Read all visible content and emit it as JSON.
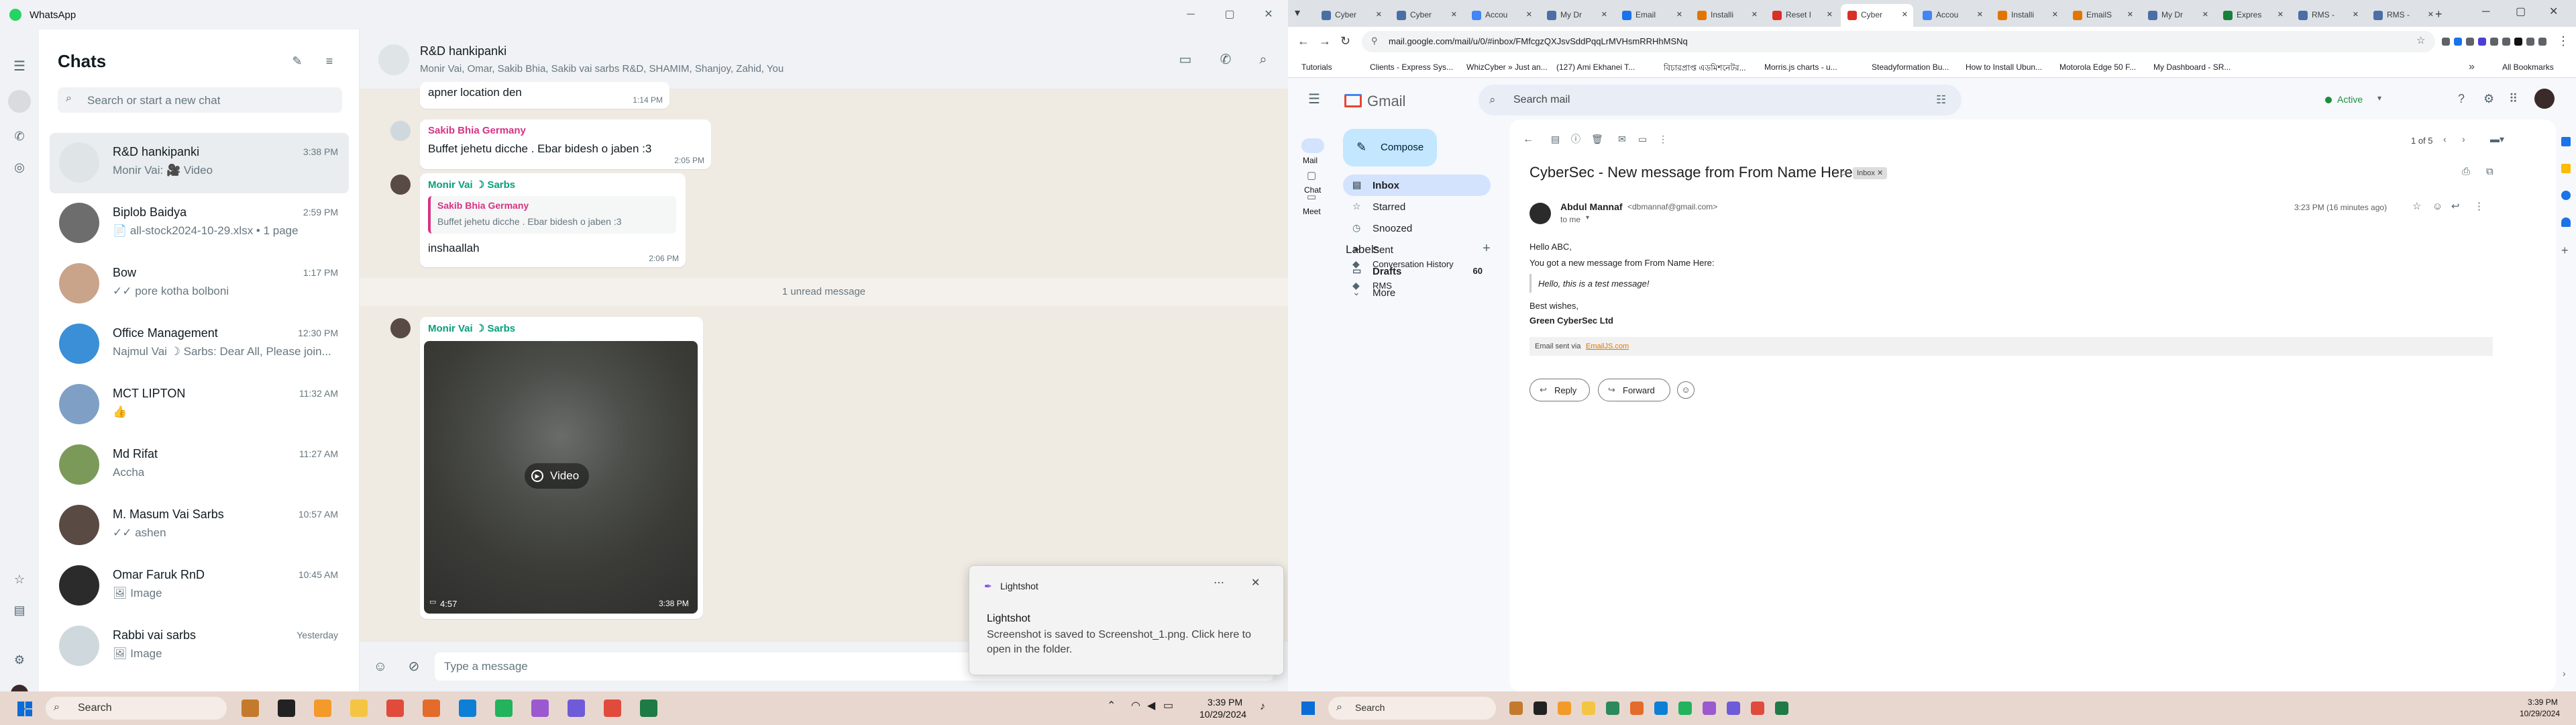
{
  "whatsapp": {
    "title": "WhatsApp",
    "list_title": "Chats",
    "search_placeholder": "Search or start a new chat",
    "chats": [
      {
        "name": "R&D hankipanki",
        "time": "3:38 PM",
        "snippet": "Monir Vai: 🎥 Video",
        "avatar_color": "#dfe5e7"
      },
      {
        "name": "Biplob Baidya",
        "time": "2:59 PM",
        "snippet": "📄 all-stock2024-10-29.xlsx • 1 page",
        "avatar_color": "#6d6d6d"
      },
      {
        "name": "Bow",
        "time": "1:17 PM",
        "snippet": "✓✓ pore kotha bolboni",
        "avatar_color": "#c9a48a"
      },
      {
        "name": "Office Management",
        "time": "12:30 PM",
        "snippet": "Najmul Vai ☽ Sarbs: Dear All, Please join...",
        "avatar_color": "#3a8fd6"
      },
      {
        "name": "MCT LIPTON",
        "time": "11:32 AM",
        "snippet": "👍",
        "avatar_color": "#7fa0c4"
      },
      {
        "name": "Md Rifat",
        "time": "11:27 AM",
        "snippet": "Accha",
        "avatar_color": "#7b9a5a"
      },
      {
        "name": "M. Masum Vai Sarbs",
        "time": "10:57 AM",
        "snippet": "✓✓ ashen",
        "avatar_color": "#5a4a44"
      },
      {
        "name": "Omar Faruk RnD",
        "time": "10:45 AM",
        "snippet": "🖼 Image",
        "avatar_color": "#2b2b2b"
      },
      {
        "name": "Rabbi vai sarbs",
        "time": "Yesterday",
        "snippet": "🖼 Image",
        "avatar_color": "#cfd8dc"
      }
    ],
    "chat_header": {
      "name": "R&D hankipanki",
      "members": "Monir Vai, Omar, Sakib Bhia, Sakib vai sarbs R&D, SHAMIM, Shanjoy, Zahid, You"
    },
    "messages": {
      "m1_text": "apner location den",
      "m1_time": "1:14 PM",
      "m2_sender": "Sakib Bhia Germany",
      "m2_text": "Buffet jehetu dicche . Ebar bidesh o jaben :3",
      "m2_time": "2:05 PM",
      "m3_sender": "Monir Vai ☽ Sarbs",
      "m3_quote_sender": "Sakib Bhia Germany",
      "m3_quote_text": "Buffet jehetu dicche . Ebar bidesh o jaben :3",
      "m3_text": "inshaallah",
      "m3_time": "2:06 PM",
      "unread_divider": "1 unread message",
      "m4_sender": "Monir Vai ☽ Sarbs",
      "m4_video_label": "Video",
      "m4_duration": "4:57",
      "m4_time": "3:38 PM"
    },
    "composer_placeholder": "Type a message",
    "toast": {
      "app": "Lightshot",
      "title": "Lightshot",
      "body": "Screenshot is saved to Screenshot_1.png. Click here to open in the folder."
    }
  },
  "taskbar_left": {
    "search_placeholder": "Search",
    "time": "3:39 PM",
    "date": "10/29/2024"
  },
  "taskbar_right": {
    "search_placeholder": "Search",
    "time": "3:39 PM",
    "date": "10/29/2024"
  },
  "chrome": {
    "tabs": [
      {
        "label": "Cyber",
        "color": "#4a6fa5"
      },
      {
        "label": "Cyber",
        "color": "#4a6fa5"
      },
      {
        "label": "Accou",
        "color": "#4285f4"
      },
      {
        "label": "My Dr",
        "color": "#4a6fa5"
      },
      {
        "label": "Email",
        "color": "#1a73e8"
      },
      {
        "label": "Installi",
        "color": "#e37400"
      },
      {
        "label": "Reset I",
        "color": "#d93025"
      },
      {
        "label": "Cyber",
        "color": "#d93025"
      },
      {
        "label": "Accou",
        "color": "#4285f4"
      },
      {
        "label": "Installi",
        "color": "#e37400"
      },
      {
        "label": "EmailS",
        "color": "#e37400"
      },
      {
        "label": "My Dr",
        "color": "#4a6fa5"
      },
      {
        "label": "Expres",
        "color": "#188038"
      },
      {
        "label": "RMS -",
        "color": "#4a6fa5"
      },
      {
        "label": "RMS -",
        "color": "#4a6fa5"
      }
    ],
    "url": "mail.google.com/mail/u/0/#inbox/FMfcgzQXJsvSddPqqLrMVHsmRRHhMSNq",
    "bookmarks": [
      "Tutorials",
      "Clients - Express Sys...",
      "WhizCyber » Just an...",
      "(127) Ami Ekhanei T...",
      "বিচারপ্রাপ্ত এডমিশনেটর...",
      "Morris.js charts - u...",
      "Steadyformation Bu...",
      "How to Install Ubun...",
      "Motorola Edge 50 F...",
      "My Dashboard - SR..."
    ],
    "all_bookmarks": "All Bookmarks"
  },
  "gmail": {
    "logo": "Gmail",
    "search_placeholder": "Search mail",
    "status": "Active",
    "compose": "Compose",
    "rail": [
      "Mail",
      "Chat",
      "Meet"
    ],
    "nav": [
      {
        "label": "Inbox",
        "count": ""
      },
      {
        "label": "Starred",
        "count": ""
      },
      {
        "label": "Snoozed",
        "count": ""
      },
      {
        "label": "Sent",
        "count": ""
      },
      {
        "label": "Drafts",
        "count": "60"
      },
      {
        "label": "More",
        "count": ""
      }
    ],
    "labels_title": "Labels",
    "labels": [
      "Conversation History",
      "RMS"
    ],
    "pager": "1 of 5",
    "subject": "CyberSec - New message from From Name Here",
    "subject_tag": "Inbox",
    "sender_name": "Abdul Mannaf",
    "sender_email": "<dbmannaf@gmail.com>",
    "to": "to me",
    "date": "3:23 PM (16 minutes ago)",
    "body": {
      "greeting": "Hello ABC,",
      "line1": "You got a new message from From Name Here:",
      "quote": "Hello, this is a test message!",
      "closing": "Best wishes,",
      "signature": "Green CyberSec Ltd",
      "footer_prefix": "Email sent via",
      "footer_link": "EmailJS.com"
    },
    "reply": "Reply",
    "forward": "Forward"
  }
}
